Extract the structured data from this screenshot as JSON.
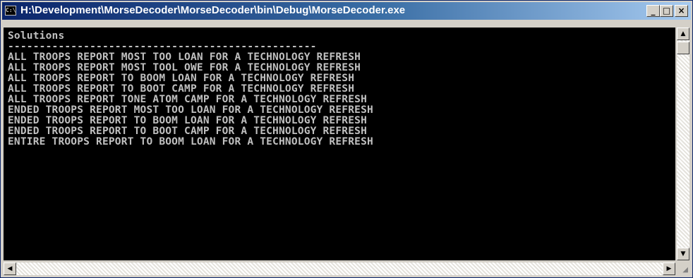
{
  "window": {
    "title": "H:\\Development\\MorseDecoder\\MorseDecoder\\bin\\Debug\\MorseDecoder.exe",
    "icon": "console-icon",
    "icon_text": "C:\\",
    "buttons": {
      "minimize": "_",
      "maximize": "□",
      "close": "×"
    }
  },
  "console": {
    "lines": [
      "Solutions",
      "-------------------------------------------------",
      "ALL TROOPS REPORT MOST TOO LOAN FOR A TECHNOLOGY REFRESH",
      "ALL TROOPS REPORT MOST TOOL OWE FOR A TECHNOLOGY REFRESH",
      "ALL TROOPS REPORT TO BOOM LOAN FOR A TECHNOLOGY REFRESH",
      "ALL TROOPS REPORT TO BOOT CAMP FOR A TECHNOLOGY REFRESH",
      "ALL TROOPS REPORT TONE ATOM CAMP FOR A TECHNOLOGY REFRESH",
      "ENDED TROOPS REPORT MOST TOO LOAN FOR A TECHNOLOGY REFRESH",
      "ENDED TROOPS REPORT TO BOOM LOAN FOR A TECHNOLOGY REFRESH",
      "ENDED TROOPS REPORT TO BOOT CAMP FOR A TECHNOLOGY REFRESH",
      "ENTIRE TROOPS REPORT TO BOOM LOAN FOR A TECHNOLOGY REFRESH"
    ]
  },
  "scrollbar": {
    "up": "▲",
    "down": "▼",
    "left": "◀",
    "right": "▶",
    "grip": "◢"
  },
  "colors": {
    "title_bar_start": "#0a246a",
    "title_bar_end": "#a6caf0",
    "console_bg": "#000000",
    "console_text": "#c0c0c0"
  }
}
